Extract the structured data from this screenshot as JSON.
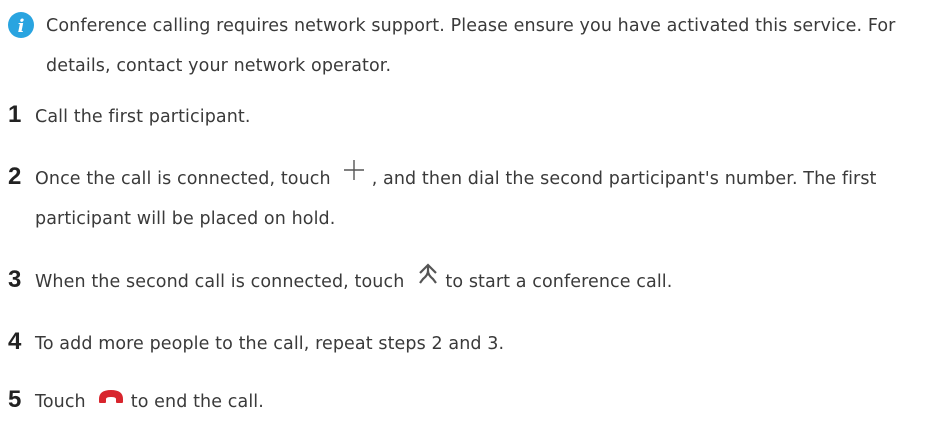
{
  "note": {
    "text": "Conference calling requires network support. Please ensure you have activated this service. For details, contact your network operator."
  },
  "steps": [
    {
      "number": "1",
      "text": "Call the first participant."
    },
    {
      "number": "2",
      "text_before_icon": "Once the call is connected, touch",
      "text_after_icon": ", and then dial the second participant's number. The first participant will be placed on hold.",
      "icon": "add-call-icon"
    },
    {
      "number": "3",
      "text_before_icon": "When the second call is connected, touch",
      "text_after_icon": "to start a conference call.",
      "icon": "merge-calls-icon"
    },
    {
      "number": "4",
      "text": "To add more people to the call, repeat steps 2 and 3."
    },
    {
      "number": "5",
      "text_before_icon": "Touch",
      "text_after_icon": "to end the call.",
      "icon": "end-call-icon"
    }
  ],
  "colors": {
    "info_icon": "#29a4e0",
    "end_call": "#d8252d",
    "text": "#3a3a3a"
  }
}
